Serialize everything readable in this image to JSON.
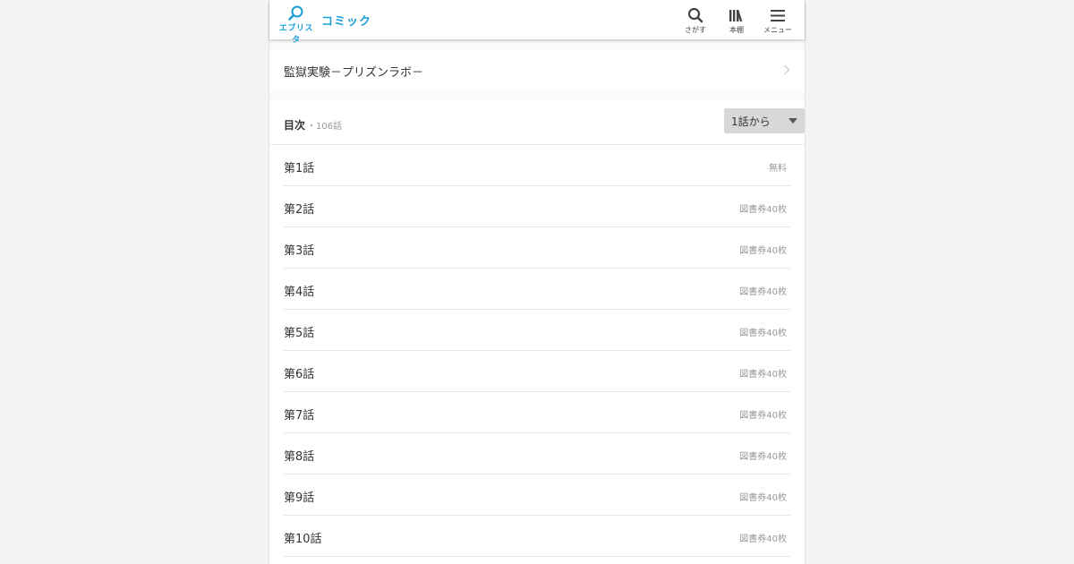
{
  "header": {
    "logo_text": "エブリスタ",
    "service_name": "コミック",
    "accent_color": "#1a9fd8",
    "buttons": [
      {
        "label": "さがす",
        "icon": "search-icon"
      },
      {
        "label": "本棚",
        "icon": "bookshelf-icon"
      },
      {
        "label": "メニュー",
        "icon": "menu-icon"
      }
    ]
  },
  "work": {
    "title": "監獄実験－プリズンラボ－"
  },
  "toc": {
    "title": "目次",
    "count": "・106話",
    "sort_selected": "1話から",
    "episodes": [
      {
        "name": "第1話",
        "price": "無料"
      },
      {
        "name": "第2話",
        "price": "図書券40枚"
      },
      {
        "name": "第3話",
        "price": "図書券40枚"
      },
      {
        "name": "第4話",
        "price": "図書券40枚"
      },
      {
        "name": "第5話",
        "price": "図書券40枚"
      },
      {
        "name": "第6話",
        "price": "図書券40枚"
      },
      {
        "name": "第7話",
        "price": "図書券40枚"
      },
      {
        "name": "第8話",
        "price": "図書券40枚"
      },
      {
        "name": "第9話",
        "price": "図書券40枚"
      },
      {
        "name": "第10話",
        "price": "図書券40枚"
      }
    ]
  }
}
